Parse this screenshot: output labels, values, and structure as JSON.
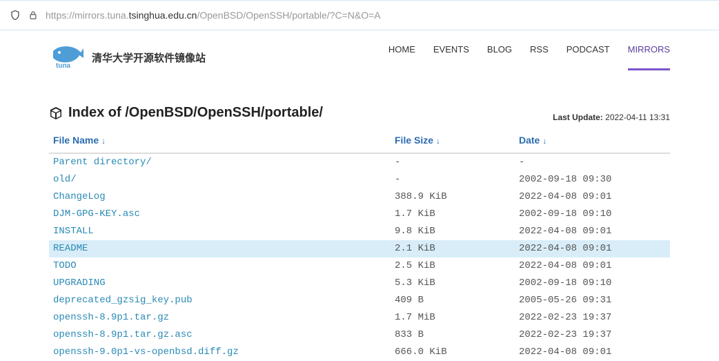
{
  "url": {
    "prefix": "https://mirrors.tuna.",
    "mid": "tsinghua.edu.cn",
    "suffix": "/OpenBSD/OpenSSH/portable/?C=N&O=A"
  },
  "brand": "清华大学开源软件镜像站",
  "nav": [
    {
      "label": "HOME"
    },
    {
      "label": "EVENTS"
    },
    {
      "label": "BLOG"
    },
    {
      "label": "RSS"
    },
    {
      "label": "PODCAST"
    },
    {
      "label": "MIRRORS",
      "active": true
    }
  ],
  "title_prefix": "Index of ",
  "title_path": "/OpenBSD/OpenSSH/portable/",
  "last_update_label": "Last Update:",
  "last_update_value": "2022-04-11 13:31",
  "columns": {
    "name": "File Name",
    "size": "File Size",
    "date": "Date"
  },
  "rows": [
    {
      "name": "Parent directory/",
      "size": "-",
      "date": "-"
    },
    {
      "name": "old/",
      "size": "-",
      "date": "2002-09-18 09:30"
    },
    {
      "name": "ChangeLog",
      "size": "388.9 KiB",
      "date": "2022-04-08 09:01"
    },
    {
      "name": "DJM-GPG-KEY.asc",
      "size": "1.7 KiB",
      "date": "2002-09-18 09:10"
    },
    {
      "name": "INSTALL",
      "size": "9.8 KiB",
      "date": "2022-04-08 09:01"
    },
    {
      "name": "README",
      "size": "2.1 KiB",
      "date": "2022-04-08 09:01",
      "highlight": true
    },
    {
      "name": "TODO",
      "size": "2.5 KiB",
      "date": "2022-04-08 09:01"
    },
    {
      "name": "UPGRADING",
      "size": "5.3 KiB",
      "date": "2002-09-18 09:10"
    },
    {
      "name": "deprecated_gzsig_key.pub",
      "size": "409 B",
      "date": "2005-05-26 09:31"
    },
    {
      "name": "openssh-8.9p1.tar.gz",
      "size": "1.7 MiB",
      "date": "2022-02-23 19:37"
    },
    {
      "name": "openssh-8.9p1.tar.gz.asc",
      "size": "833 B",
      "date": "2022-02-23 19:37"
    },
    {
      "name": "openssh-9.0p1-vs-openbsd.diff.gz",
      "size": "666.0 KiB",
      "date": "2022-04-08 09:01"
    }
  ]
}
